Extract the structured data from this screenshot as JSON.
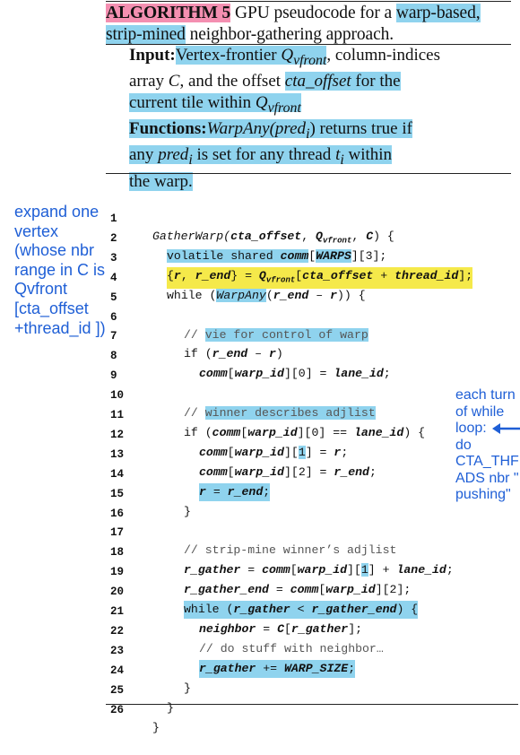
{
  "caption": {
    "label": "ALGORITHM 5",
    "text_1": " GPU pseudocode for a ",
    "text_2": "warp-based, strip-mined",
    "text_3": " neighbor-gathering approach."
  },
  "io": {
    "input_label": "Input:",
    "input_1": "Vertex-frontier ",
    "input_q": "Q",
    "input_qsub": "vfront",
    "input_2": ", column-indices",
    "input_3": "array ",
    "input_c": "C",
    "input_4": ", and the offset ",
    "input_cta": "cta_offset",
    "input_5": " for the",
    "input_6": "current tile within ",
    "functions_label": "Functions:",
    "func_1": "WarpAny",
    "func_2": "(pred",
    "func_sub": "i",
    "func_3": ") returns true if",
    "func_4": "any ",
    "func_5": "pred",
    "func_6": " is set for any thread ",
    "func_7": "t",
    "func_8": " within",
    "func_9": "the warp."
  },
  "notes": {
    "left": "expand one vertex (whose nbr range in C is Qvfront [cta_offset +thread_id ])",
    "right_lines": [
      "each turn",
      "of while",
      "loop:",
      "do",
      "CTA_THF",
      "ADS nbr \"",
      "pushing\""
    ]
  },
  "code": [
    {
      "n": "1"
    },
    {
      "n": "2"
    },
    {
      "n": "3"
    },
    {
      "n": "4"
    },
    {
      "n": "5"
    },
    {
      "n": "6"
    },
    {
      "n": "7"
    },
    {
      "n": "8"
    },
    {
      "n": "9"
    },
    {
      "n": "10"
    },
    {
      "n": "11"
    },
    {
      "n": "12"
    },
    {
      "n": "13"
    },
    {
      "n": "14"
    },
    {
      "n": "15"
    },
    {
      "n": "16"
    },
    {
      "n": "17"
    },
    {
      "n": "18"
    },
    {
      "n": "19"
    },
    {
      "n": "20"
    },
    {
      "n": "21"
    },
    {
      "n": "22"
    },
    {
      "n": "23"
    },
    {
      "n": "24"
    },
    {
      "n": "25"
    },
    {
      "n": "26"
    }
  ],
  "code_text": {
    "l1a": "GatherWarp(",
    "l1b": "cta_offset",
    "l1c": ", ",
    "l1q": "Q",
    "l1qs": "vfront",
    "l1d": ", ",
    "l1e": "C",
    "l1f": ") {",
    "l2a": "volatile shared ",
    "l2b": "comm",
    "l2c": "[",
    "l2d": "WARPS",
    "l2e": "][3];",
    "l3a": "{",
    "l3b": "r",
    "l3c": ", ",
    "l3d": "r_end",
    "l3e": "}",
    "l3f": " = ",
    "l3q": "Q",
    "l3qs": "vfront",
    "l3g": "[",
    "l3h": "cta_offset",
    "l3i": " + ",
    "l3j": "thread_id",
    "l3k": "];",
    "l4a": "while (",
    "l4b": "WarpAny",
    "l4c": "(",
    "l4d": "r_end",
    "l4e": " – ",
    "l4f": "r",
    "l4g": ")) {",
    "l6a": "// ",
    "l6b": "vie for control of warp",
    "l7a": "if (",
    "l7b": "r_end",
    "l7c": " – ",
    "l7d": "r",
    "l7e": ")",
    "l8a": "comm",
    "l8b": "[",
    "l8c": "warp_id",
    "l8d": "][0] = ",
    "l8e": "lane_id",
    "l8f": ";",
    "l10a": "// ",
    "l10b": "winner describes adjlist",
    "l11a": "if (",
    "l11b": "comm",
    "l11c": "[",
    "l11d": "warp_id",
    "l11e": "][0] == ",
    "l11f": "lane_id",
    "l11g": ") {",
    "l12a": "comm",
    "l12b": "[",
    "l12c": "warp_id",
    "l12d": "][",
    "l12e": "1",
    "l12f": "] = ",
    "l12g": "r",
    "l12h": ";",
    "l13a": "comm",
    "l13b": "[",
    "l13c": "warp_id",
    "l13d": "][",
    "l13e": "2",
    "l13f": "] = ",
    "l13g": "r_end",
    "l13h": ";",
    "l14a": "r",
    "l14b": " = ",
    "l14c": "r_end",
    "l14d": ";",
    "l15a": "}",
    "l17a": "// strip-mine winner’s adjlist",
    "l18a": "r_gather",
    "l18b": " = ",
    "l18c": "comm",
    "l18d": "[",
    "l18e": "warp_id",
    "l18f": "][",
    "l18g": "1",
    "l18h": "] + ",
    "l18i": "lane_id",
    "l18j": ";",
    "l19a": "r_gather_end",
    "l19b": " = ",
    "l19c": "comm",
    "l19d": "[",
    "l19e": "warp_id",
    "l19f": "][2];",
    "l20a": "while (",
    "l20b": "r_gather",
    "l20c": " < ",
    "l20d": "r_gather_end",
    "l20e": ") {",
    "l21a": "neighbor",
    "l21b": " = ",
    "l21c": "C",
    "l21d": "[",
    "l21e": "r_gather",
    "l21f": "];",
    "l22a": "// do stuff with neighbor…",
    "l23a": "r_gather",
    "l23b": " += ",
    "l23c": "WARP_SIZE",
    "l23d": ";",
    "l24a": "}",
    "l25a": "}",
    "l26a": "}"
  },
  "colors": {
    "highlight_blue": "#8fd3ee",
    "highlight_pink": "#f48fb1",
    "highlight_yellow": "#f5e94a",
    "annotation_blue": "#1f5fd6"
  }
}
